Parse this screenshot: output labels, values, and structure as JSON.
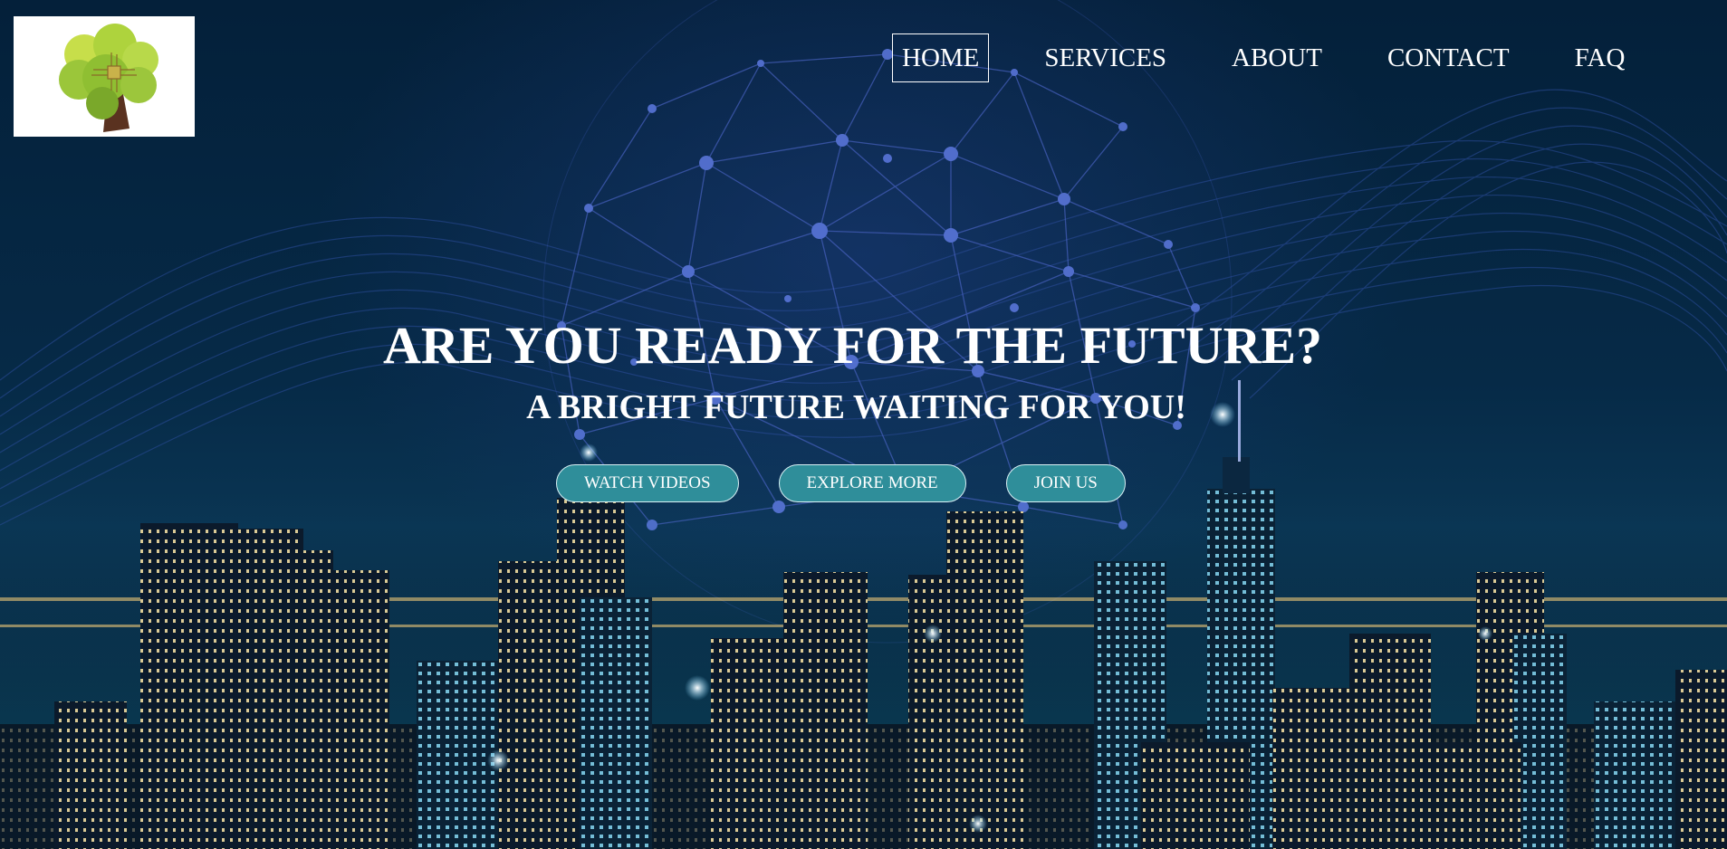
{
  "nav": {
    "items": [
      {
        "label": "HOME",
        "active": true
      },
      {
        "label": "SERVICES",
        "active": false
      },
      {
        "label": "ABOUT",
        "active": false
      },
      {
        "label": "CONTACT",
        "active": false
      },
      {
        "label": "FAQ",
        "active": false
      }
    ]
  },
  "hero": {
    "title": "ARE YOU READY FOR THE FUTURE?",
    "subtitle": "A BRIGHT FUTURE WAITING FOR YOU!",
    "buttons": [
      {
        "label": "WATCH VIDEOS"
      },
      {
        "label": "EXPLORE MORE"
      },
      {
        "label": "JOIN US"
      }
    ]
  },
  "colors": {
    "button_bg": "#2f8e9a",
    "background": "#05182b",
    "text": "#ffffff"
  },
  "icons": {
    "logo": "tree-circuit-logo-icon"
  }
}
